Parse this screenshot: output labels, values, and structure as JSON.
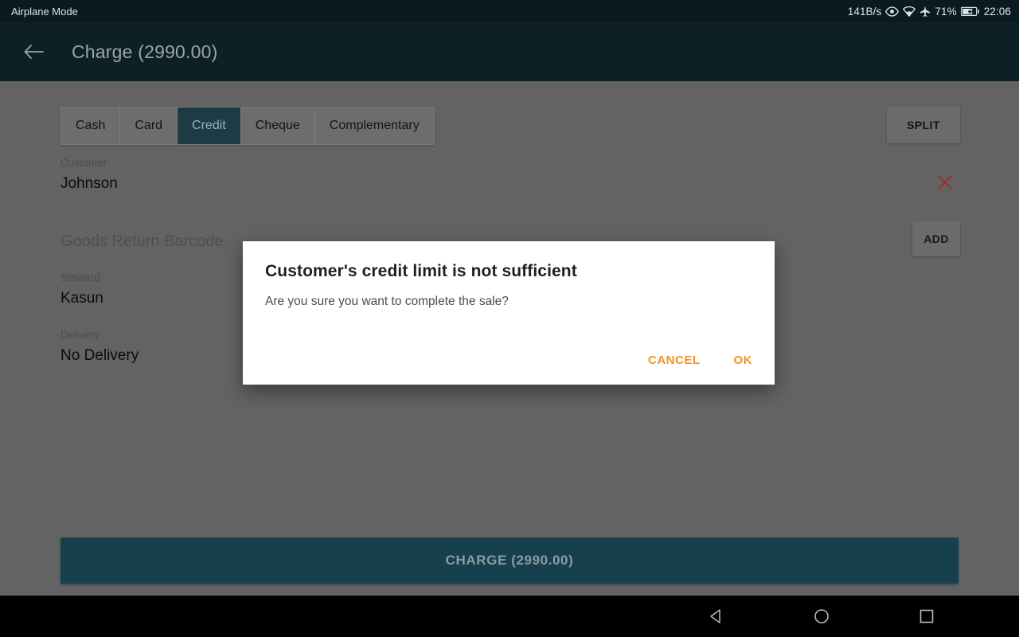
{
  "status_bar": {
    "left_text": "Airplane Mode",
    "network_speed": "141B/s",
    "battery_percent": "71%",
    "clock": "22:06",
    "icons": [
      "eye-icon",
      "wifi-icon",
      "airplane-icon",
      "battery-charging-icon"
    ]
  },
  "app_bar": {
    "back_icon": "back-arrow-icon",
    "title": "Charge (2990.00)"
  },
  "tabs": [
    {
      "label": "Cash",
      "selected": false
    },
    {
      "label": "Card",
      "selected": false
    },
    {
      "label": "Credit",
      "selected": true
    },
    {
      "label": "Cheque",
      "selected": false
    },
    {
      "label": "Complementary",
      "selected": false
    }
  ],
  "actions": {
    "split_label": "SPLIT",
    "add_label": "ADD",
    "clear_icon": "close-x-icon"
  },
  "fields": {
    "customer_label": "Customer",
    "customer_value": "Johnson",
    "barcode_placeholder": "Goods Return Barcode",
    "steward_label": "Steward",
    "steward_value": "Kasun",
    "delivery_label": "Delivery",
    "delivery_value": "No Delivery"
  },
  "charge_button": {
    "label": "CHARGE (2990.00)"
  },
  "dialog": {
    "title": "Customer's credit limit is not sufficient",
    "message": "Are you sure you want to complete the sale?",
    "cancel_label": "CANCEL",
    "ok_label": "OK"
  },
  "nav_bar": {
    "back": "nav-back-icon",
    "home": "nav-home-icon",
    "recents": "nav-recents-icon"
  },
  "colors": {
    "app_bar": "#0d2026",
    "status_bar": "#0b1a20",
    "scrim": "#636363",
    "accent_teal": "#17404f",
    "tab_selected": "#1d3b45",
    "dialog_accent": "#f2941f",
    "clear_icon": "#a03028"
  }
}
